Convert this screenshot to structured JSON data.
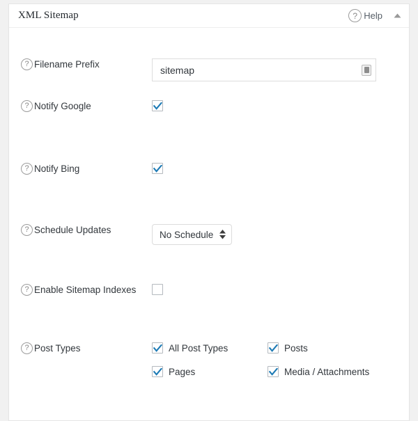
{
  "panel": {
    "title": "XML Sitemap",
    "help_label": "Help",
    "help_icon": "question-circle-icon",
    "collapse_icon": "triangle-up-icon"
  },
  "rows": {
    "filename_prefix": {
      "label": "Filename Prefix",
      "help_icon": "question-circle-icon",
      "input_value": "sitemap",
      "input_placeholder": "sitemap",
      "affordance_icon": "form-autofill-icon"
    },
    "notify_google": {
      "label": "Notify Google",
      "help_icon": "question-circle-icon",
      "checked": true
    },
    "notify_bing": {
      "label": "Notify Bing",
      "help_icon": "question-circle-icon",
      "checked": true
    },
    "schedule_updates": {
      "label": "Schedule Updates",
      "help_icon": "question-circle-icon",
      "selected": "No Schedule",
      "options": [
        "No Schedule"
      ],
      "stepper_icon": "updown-arrows-icon"
    },
    "enable_sitemap_indexes": {
      "label": "Enable Sitemap Indexes",
      "help_icon": "question-circle-icon",
      "checked": false
    },
    "post_types": {
      "label": "Post Types",
      "help_icon": "question-circle-icon",
      "items": [
        {
          "label": "All Post Types",
          "checked": true
        },
        {
          "label": "Posts",
          "checked": true
        },
        {
          "label": "Pages",
          "checked": true
        },
        {
          "label": "Media / Attachments",
          "checked": true
        }
      ]
    }
  },
  "colors": {
    "page_background": "#f1f1f1",
    "panel_background": "#ffffff",
    "panel_border": "#e5e5e5",
    "checkbox_accent": "#1e7bb5",
    "text": "#32373c",
    "muted_text": "#555d66"
  },
  "glyphs": {
    "question_mark": "?"
  }
}
